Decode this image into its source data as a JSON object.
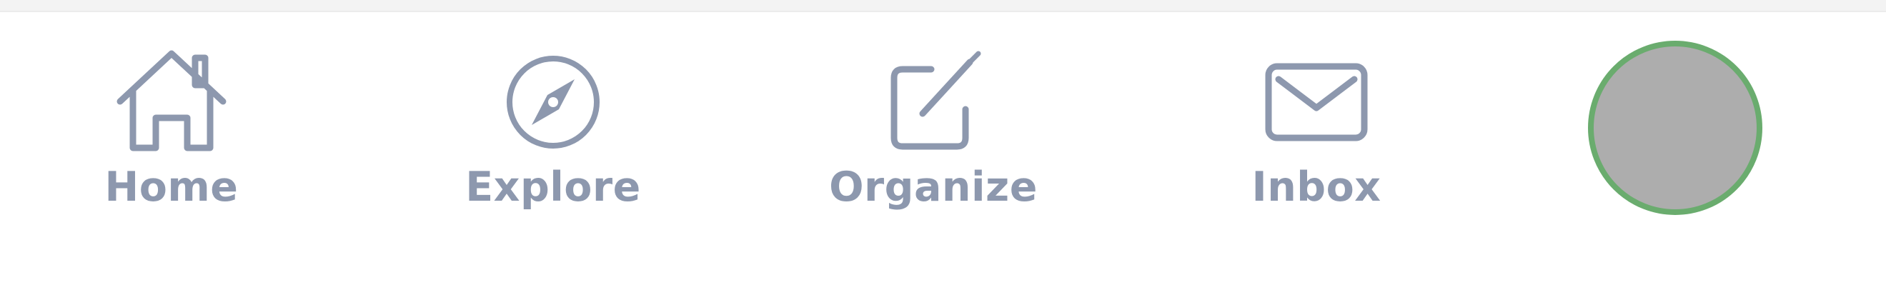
{
  "nav": {
    "items": [
      {
        "label": "Home",
        "icon": "home-icon"
      },
      {
        "label": "Explore",
        "icon": "compass-icon"
      },
      {
        "label": "Organize",
        "icon": "edit-icon"
      },
      {
        "label": "Inbox",
        "icon": "mail-icon"
      }
    ],
    "avatar": {
      "icon": "user-avatar"
    }
  },
  "colors": {
    "icon": "#8d98ae",
    "avatar_fill": "#adadad",
    "avatar_ring": "#6aac6e",
    "background": "#ffffff"
  }
}
